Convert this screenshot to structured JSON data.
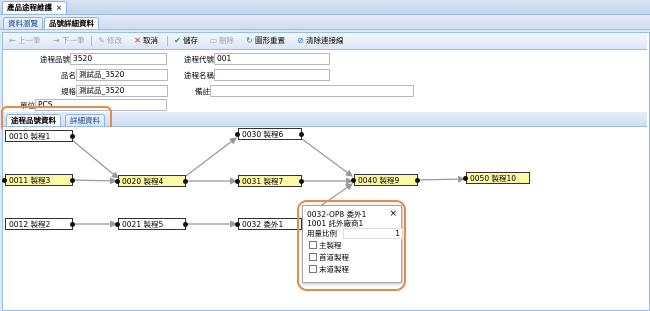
{
  "window_tab": {
    "title": "產品途程維護",
    "close": "×"
  },
  "sub_tabs": [
    {
      "label": "資料瀏覽"
    },
    {
      "label": "品號詳細資料"
    }
  ],
  "toolbar": {
    "prev": "上一筆",
    "next": "下一筆",
    "edit": "修改",
    "cancel": "取消",
    "save": "儲存",
    "delete": "刪除",
    "redraw": "圖形重置",
    "clear_links": "清除連接線"
  },
  "form": {
    "item_no_label": "途程品號",
    "item_no_value": "3520",
    "item_name_label": "品名",
    "item_name_value": "測試品_3520",
    "spec_label": "規格",
    "spec_value": "測試品_3520",
    "unit_label": "單位",
    "unit_value": "PCS",
    "route_code_label": "途程代號",
    "route_code_value": "001",
    "route_name_label": "途程名稱",
    "route_name_value": "",
    "remark_label": "備註",
    "remark_value": ""
  },
  "inner_tabs": [
    {
      "label": "途程品號資料"
    },
    {
      "label": "詳細資料"
    }
  ],
  "nodes": [
    {
      "label": "0010 製程1",
      "color": "white"
    },
    {
      "label": "0011 製程3",
      "color": "yellow"
    },
    {
      "label": "0012 製程2",
      "color": "white"
    },
    {
      "label": "0020 製程4",
      "color": "yellow"
    },
    {
      "label": "0021 製程5",
      "color": "white"
    },
    {
      "label": "0030 製程6",
      "color": "white"
    },
    {
      "label": "0031 製程7",
      "color": "yellow"
    },
    {
      "label": "0032 委外1",
      "color": "white"
    },
    {
      "label": "0040 製程9",
      "color": "yellow"
    },
    {
      "label": "0050 製程10",
      "color": "yellow"
    }
  ],
  "popup": {
    "line1": "0032-OP8 委外1",
    "line2": "1001 託外廠商1",
    "ratio_label": "用量比例",
    "ratio_value": "1",
    "close": "×",
    "checks": [
      {
        "label": "主製程"
      },
      {
        "label": "首道製程"
      },
      {
        "label": "末道製程"
      }
    ]
  },
  "colors": {
    "highlight": "#e8884a",
    "node_yellow": "#fbf9a6",
    "edge": "#999999"
  }
}
